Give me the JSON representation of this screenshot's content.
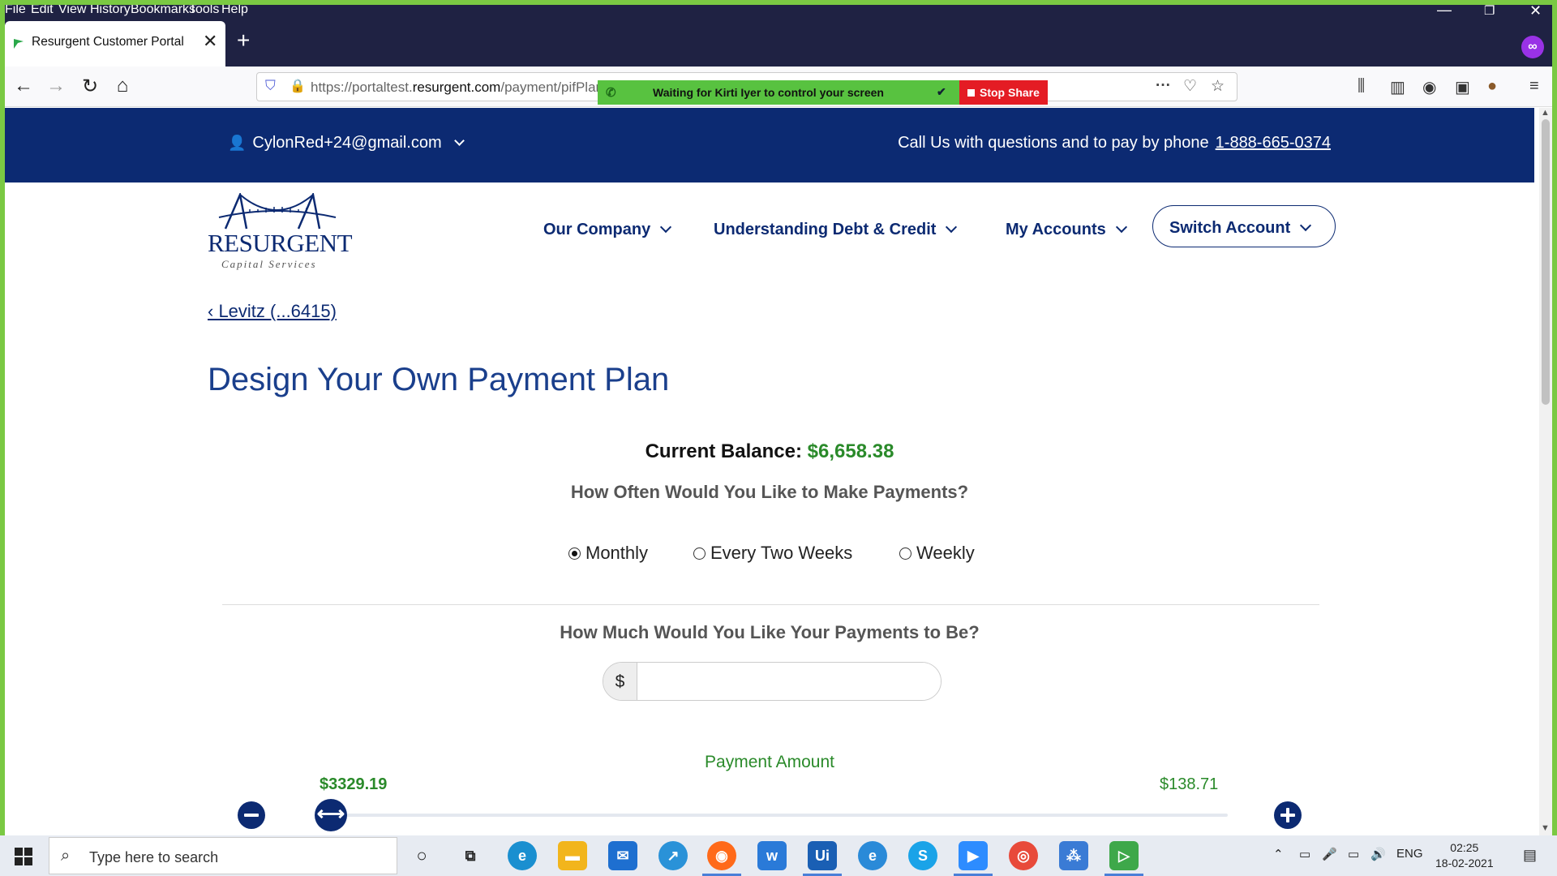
{
  "browser": {
    "menu": [
      "File",
      "Edit",
      "View",
      "History",
      "Bookmarks",
      "Tools",
      "Help"
    ],
    "tab_title": "Resurgent Customer Portal",
    "url_prefix": "https://portaltest.",
    "url_domain": "resurgent.com",
    "url_path": "/payment/pifPlanDesigner",
    "share_message": "Waiting for Kirti Iyer to control your screen",
    "stop_share_label": "Stop Share"
  },
  "topbar": {
    "user_email": "CylonRed+24@gmail.com",
    "call_text": "Call Us with questions and to pay by phone",
    "phone": "1-888-665-0374"
  },
  "logo": {
    "name": "RESURGENT",
    "subtitle": "Capital Services"
  },
  "nav": {
    "our_company": "Our Company",
    "understanding": "Understanding Debt & Credit",
    "my_accounts": "My Accounts",
    "switch_account": "Switch Account"
  },
  "page": {
    "back_link": "‹ Levitz (...6415)",
    "title": "Design Your Own Payment Plan",
    "balance_label": "Current Balance:",
    "balance_value": "$6,658.38",
    "frequency_question": "How Often Would You Like to Make Payments?",
    "frequency_options": [
      "Monthly",
      "Every Two Weeks",
      "Weekly"
    ],
    "frequency_selected": "Monthly",
    "amount_question": "How Much Would You Like Your Payments to Be?",
    "currency_symbol": "$",
    "amount_value": "",
    "slider_label": "Payment Amount",
    "slider_max": "$3329.19",
    "slider_min": "$138.71"
  },
  "taskbar": {
    "search_placeholder": "Type here to search",
    "language": "ENG",
    "time": "02:25",
    "date": "18-02-2021"
  },
  "colors": {
    "brand_navy": "#0c2a72",
    "money_green": "#2a8a2a",
    "share_green": "#58c240",
    "stop_red": "#e41c24"
  }
}
